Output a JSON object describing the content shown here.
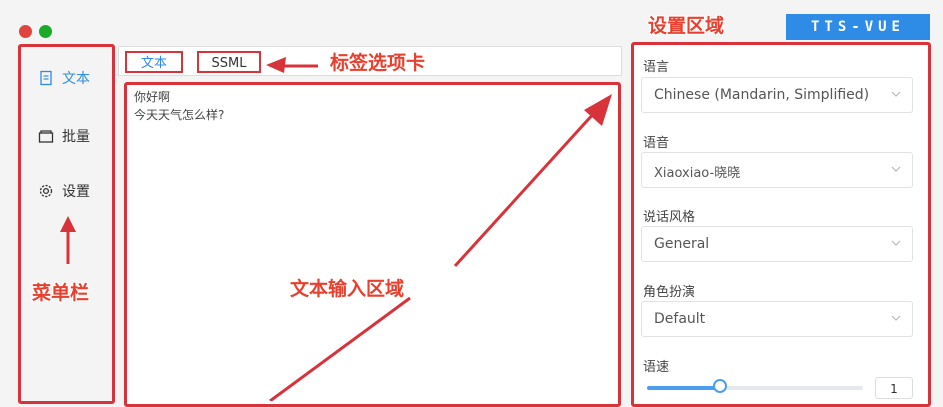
{
  "window": {
    "close_color": "#e0443e",
    "max_color": "#1aab29"
  },
  "brand": "TTS-VUE",
  "sidebar": {
    "items": [
      {
        "label": "文本",
        "icon": "document-icon",
        "active": true
      },
      {
        "label": "批量",
        "icon": "folder-icon",
        "active": false
      },
      {
        "label": "设置",
        "icon": "gear-icon",
        "active": false
      }
    ]
  },
  "tabs": [
    {
      "label": "文本"
    },
    {
      "label": "SSML"
    }
  ],
  "editor": {
    "lines": [
      "你好啊",
      "今天天气怎么样?"
    ]
  },
  "settings": {
    "language_label": "语言",
    "language_value": "Chinese (Mandarin, Simplified)",
    "voice_label": "语音",
    "voice_value": "Xiaoxiao-晓晓",
    "style_label": "说话风格",
    "style_value": "General",
    "role_label": "角色扮演",
    "role_value": "Default",
    "speed_label": "语速",
    "speed_value": "1",
    "speed_fraction": 0.34
  },
  "annotations": {
    "settings_area": "设置区域",
    "tab_label": "标签选项卡",
    "menu_bar": "菜单栏",
    "text_input_area": "文本输入区域"
  },
  "colors": {
    "accent": "#2e8be6",
    "annotation": "#d8333a"
  }
}
